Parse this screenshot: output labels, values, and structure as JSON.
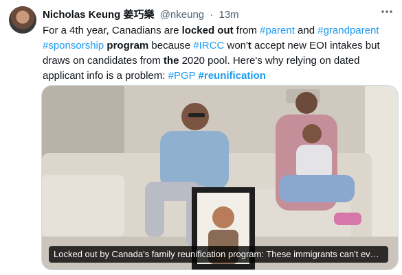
{
  "author": {
    "name": "Nicholas Keung 姜巧樂",
    "handle": "@nkeung",
    "separator": "·",
    "time": "13m"
  },
  "more_icon": "more-dots-icon",
  "tweet": {
    "segments": [
      {
        "t": "For a 4th year, Canadians are ",
        "s": "text"
      },
      {
        "t": "locked out",
        "s": "bold"
      },
      {
        "t": " from ",
        "s": "text"
      },
      {
        "t": "#parent",
        "s": "tag"
      },
      {
        "t": " and ",
        "s": "text"
      },
      {
        "t": "#grandparent",
        "s": "tag"
      },
      {
        "t": " ",
        "s": "text"
      },
      {
        "t": "#sponsorship",
        "s": "tag"
      },
      {
        "t": " ",
        "s": "text"
      },
      {
        "t": "program",
        "s": "bold"
      },
      {
        "t": " because ",
        "s": "text"
      },
      {
        "t": "#IRCC",
        "s": "tag"
      },
      {
        "t": " won'",
        "s": "text"
      },
      {
        "t": "t",
        "s": "bold"
      },
      {
        "t": " accept new EOI intakes but draws on candidates from ",
        "s": "text"
      },
      {
        "t": "the",
        "s": "bold"
      },
      {
        "t": " 2020 pool. Here's why relying on  dated applicant info is a problem: ",
        "s": "text"
      },
      {
        "t": "#PGP",
        "s": "tag"
      },
      {
        "t": " ",
        "s": "text"
      },
      {
        "t": "#reunification",
        "s": "tagbold"
      }
    ]
  },
  "card": {
    "caption": "Locked out by Canada's family reunification program: These immigrants can't even…"
  },
  "colors": {
    "link": "#1d9bf0",
    "text": "#0f1419",
    "muted": "#536471"
  }
}
